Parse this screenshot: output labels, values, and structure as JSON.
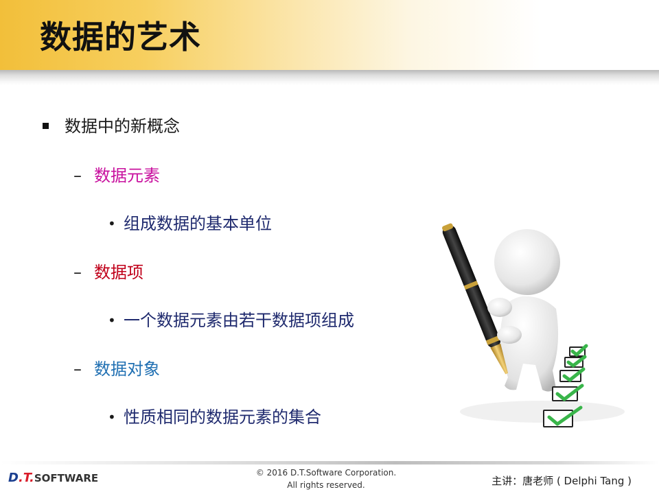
{
  "slide": {
    "title": "数据的艺术",
    "bullets": {
      "b1": "数据中的新概念",
      "b1_1": "数据元素",
      "b1_1_1": "组成数据的基本单位",
      "b1_2": "数据项",
      "b1_2_1": "一个数据元素由若干数据项组成",
      "b1_3": "数据对象",
      "b1_3_1": "性质相同的数据元素的集合"
    },
    "markers": {
      "level2": "–",
      "level3": "•"
    }
  },
  "colors": {
    "element": "#c8109e",
    "item": "#c0001a",
    "object": "#1f6fb2",
    "level3_text": "#1f2a6e"
  },
  "footer": {
    "logo_dt": "D",
    "logo_dot": ".T.",
    "logo_soft": "SOFTWARE",
    "copyright_line1": "© 2016 D.T.Software Corporation.",
    "copyright_line2": "All rights reserved.",
    "speaker": "主讲：唐老师 ( Delphi Tang )"
  },
  "illustration": {
    "icon": "figure-with-pen-and-checkboxes",
    "checkbox_count": 5
  }
}
